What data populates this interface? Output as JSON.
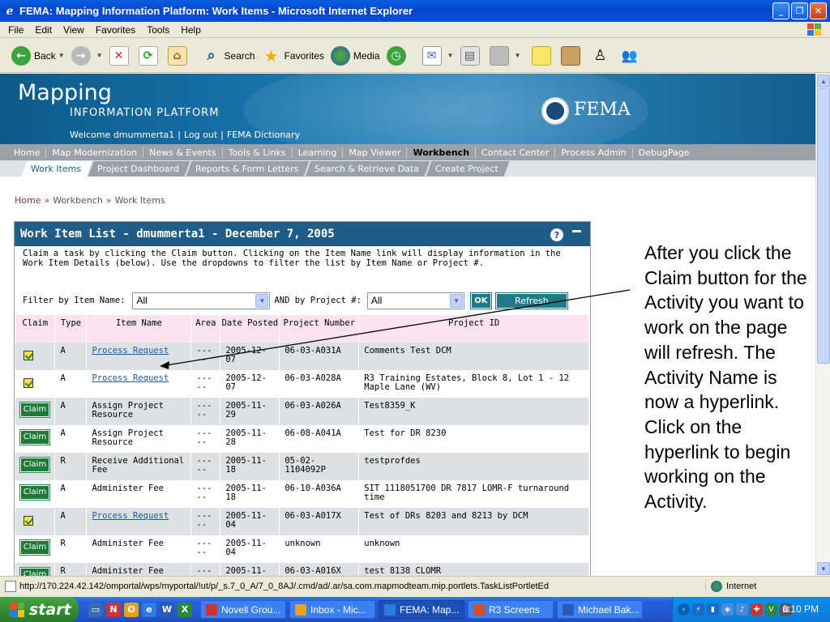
{
  "window": {
    "title": "FEMA: Mapping Information Platform: Work Items - Microsoft Internet Explorer",
    "min": "_",
    "max": "❐",
    "close": "✕"
  },
  "menu": [
    "File",
    "Edit",
    "View",
    "Favorites",
    "Tools",
    "Help"
  ],
  "toolbar": {
    "back": "Back",
    "search": "Search",
    "favorites": "Favorites",
    "media": "Media"
  },
  "banner": {
    "brand_main": "Mapping",
    "brand_sub": "INFORMATION PLATFORM",
    "welcome": "Welcome dmummerta1",
    "logout": "Log out",
    "dictionary": "FEMA Dictionary",
    "sep": "|",
    "fema": "FEMA"
  },
  "nav": {
    "primary": [
      "Home",
      "Map Modernization",
      "News & Events",
      "Tools & Links",
      "Learning",
      "Map Viewer",
      "Workbench",
      "Contact Center",
      "Process Admin",
      "DebugPage"
    ],
    "primary_active": "Workbench",
    "secondary": [
      "Work Items",
      "Project Dashboard",
      "Reports & Form Letters",
      "Search & Retrieve Data",
      "Create Project"
    ],
    "secondary_active": "Work Items"
  },
  "breadcrumb": {
    "home": "Home",
    "sep": "»",
    "workbench": "Workbench",
    "current": "Work Items"
  },
  "portlet": {
    "title": "Work Item List - dmummerta1 - December 7, 2005",
    "help": "?",
    "instructions": "Claim a task by clicking the Claim button. Clicking on the Item Name link will display information in the Work Item Details (below). Use the dropdowns to filter the list by Item Name or Project #.",
    "filter_label": "Filter by Item Name:",
    "filter_value": "All",
    "and_label": "AND by Project #:",
    "project_value": "All",
    "ok": "OK",
    "refresh": "Refresh",
    "columns": [
      "Claim",
      "Type",
      "Item Name",
      "Area",
      "Date Posted",
      "Project Number",
      "Project ID"
    ],
    "claim_label": "Claim",
    "rows": [
      {
        "claimed": true,
        "type": "A",
        "item": "Process Request",
        "area": "-----",
        "date": "2005-12-07",
        "project_number": "06-03-A031A",
        "project_id": "Comments Test DCM"
      },
      {
        "claimed": true,
        "type": "A",
        "item": "Process Request",
        "area": "-----",
        "date": "2005-12-07",
        "project_number": "06-03-A028A",
        "project_id": "R3 Training Estates, Block 8, Lot 1 - 12 Maple Lane (WV)"
      },
      {
        "claimed": false,
        "type": "A",
        "item": "Assign Project Resource",
        "area": "-----",
        "date": "2005-11-29",
        "project_number": "06-03-A026A",
        "project_id": "Test8359_K"
      },
      {
        "claimed": false,
        "type": "A",
        "item": "Assign Project Resource",
        "area": "-----",
        "date": "2005-11-28",
        "project_number": "06-08-A041A",
        "project_id": "Test for DR 8230"
      },
      {
        "claimed": false,
        "type": "R",
        "item": "Receive Additional Fee",
        "area": "-----",
        "date": "2005-11-18",
        "project_number": "05-02-1104092P",
        "project_id": "testprofdes"
      },
      {
        "claimed": false,
        "type": "A",
        "item": "Administer Fee",
        "area": "-----",
        "date": "2005-11-18",
        "project_number": "06-10-A036A",
        "project_id": "SIT 1118051700 DR 7817 LOMR-F turnaround time"
      },
      {
        "claimed": true,
        "type": "A",
        "item": "Process Request",
        "area": "-----",
        "date": "2005-11-04",
        "project_number": "06-03-A017X",
        "project_id": "Test of DRs 8203 and 8213 by DCM"
      },
      {
        "claimed": false,
        "type": "R",
        "item": "Administer Fee",
        "area": "-----",
        "date": "2005-11-04",
        "project_number": "unknown",
        "project_id": "unknown"
      },
      {
        "claimed": false,
        "type": "R",
        "item": "Administer Fee",
        "area": "-----",
        "date": "2005-11-",
        "project_number": "06-03-A016X",
        "project_id": "test 8138 CLOMR"
      }
    ]
  },
  "annotation": "After you click the Claim button for the Activity you want to work on the page will refresh. The Activity Name is now a hyperlink. Click on the hyperlink to begin working on the Activity.",
  "status": {
    "url": "http://170.224.42.142/omportal/wps/myportal/!ut/p/_s.7_0_A/7_0_8AJ/.cmd/ad/.ar/sa.com.mapmodteam.mip.portlets.TaskListPortletEd",
    "zone": "Internet"
  },
  "taskbar": {
    "start": "start",
    "tasks": [
      "Novell Grou...",
      "Inbox - Mic...",
      "FEMA: Map...",
      "R3 Screens",
      "Michael Bak..."
    ],
    "active_task": "FEMA: Map...",
    "clock": "6:10 PM"
  },
  "colors": {
    "banner": "#1f5d86",
    "nav_gray": "#9aa1a8",
    "header_pink": "#fbe3f2",
    "claim_green": "#1f7a3a",
    "button_teal": "#1f7a8c"
  }
}
